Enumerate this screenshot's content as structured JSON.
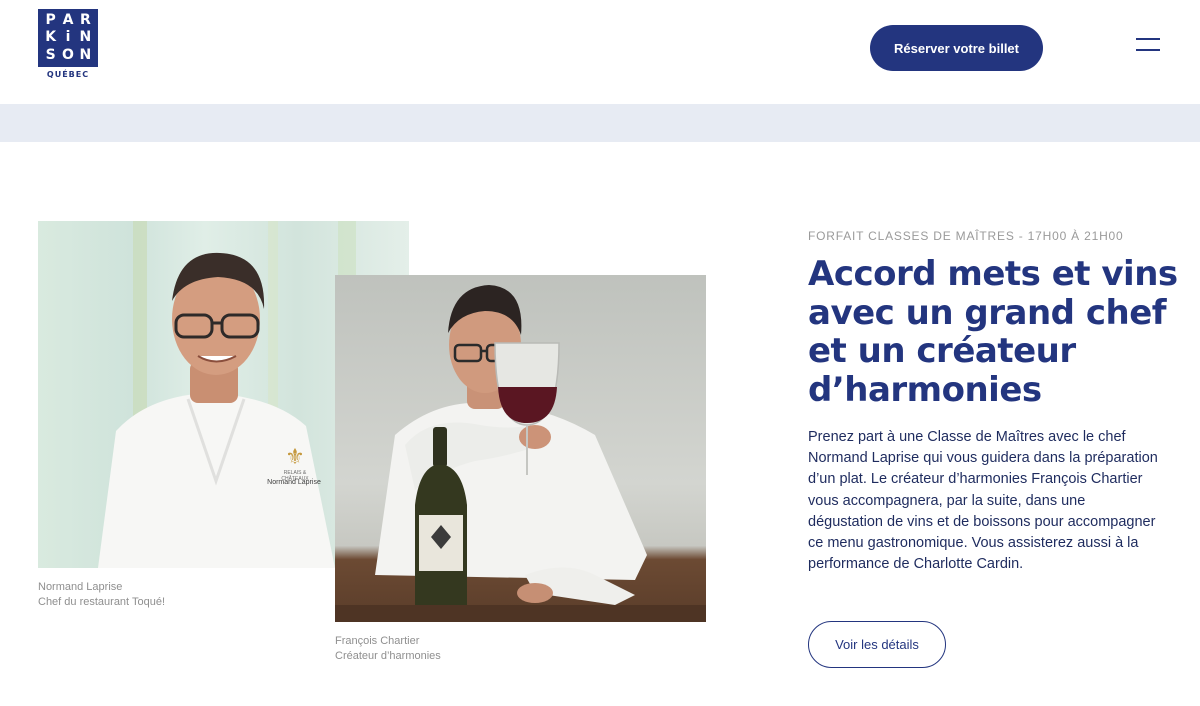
{
  "header": {
    "logo": {
      "letters": [
        "P",
        "A",
        "R",
        "K",
        "i",
        "N",
        "S",
        "O",
        "N"
      ],
      "subtitle": "QUÉBEC"
    },
    "reserve_label": "Réserver votre billet",
    "menu_icon": "hamburger-menu-icon"
  },
  "portraits": [
    {
      "name": "Normand Laprise",
      "role": "Chef du restaurant Toqué!",
      "jacket_embroidery": [
        "RELAIS &",
        "CHÂTEAUX",
        "Normand Laprise"
      ]
    },
    {
      "name": "François Chartier",
      "role": "Créateur d’harmonies"
    }
  ],
  "content": {
    "eyebrow": "FORFAIT CLASSES DE MAÎTRES - 17H00 À 21H00",
    "title": "Accord mets et vins avec un grand chef et un créateur d’harmonies",
    "body": "Prenez part à une Classe de Maîtres avec le chef Normand Laprise qui vous guidera dans la préparation d’un plat. Le créateur d’harmonies François Chartier vous accompagnera, par la suite, dans une dégustation de vins et de boissons pour accompagner ce menu gastronomique. Vous assisterez aussi à la performance de Charlotte Cardin.",
    "details_label": "Voir les détails"
  },
  "colors": {
    "brand_blue": "#23357f",
    "band": "#e7ebf3",
    "caption_gray": "#8f8f8f"
  }
}
